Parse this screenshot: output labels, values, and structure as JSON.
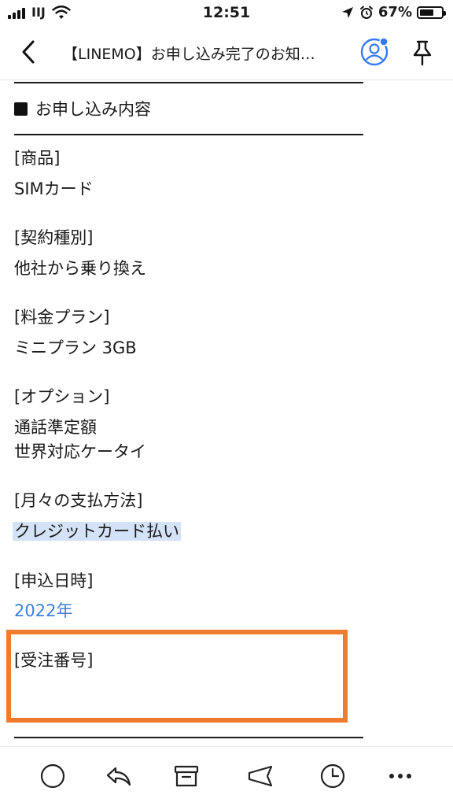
{
  "status_bar": {
    "carrier": "IIJ",
    "time": "12:51",
    "battery_percent_label": "67%",
    "battery_level": 0.67
  },
  "header": {
    "title": "【LINEMO】お申し込み完了のお知…"
  },
  "email": {
    "section_heading": "お申し込み内容",
    "fields": [
      {
        "label": "[商品]",
        "values": [
          "SIMカード"
        ]
      },
      {
        "label": "[契約種別]",
        "values": [
          "他社から乗り換え"
        ]
      },
      {
        "label": "[料金プラン]",
        "values": [
          "ミニプラン 3GB"
        ]
      },
      {
        "label": "[オプション]",
        "values": [
          "通話準定額",
          "世界対応ケータイ"
        ]
      },
      {
        "label": "[月々の支払方法]",
        "values": [
          "クレジットカード払い"
        ]
      },
      {
        "label": "[申込日時]",
        "values": [
          "2022年"
        ]
      },
      {
        "label": "[受注番号]",
        "values": []
      }
    ]
  },
  "colors": {
    "highlight_bg": "#d4e2f7",
    "link": "#3d7fd9",
    "annotation_box": "#f07a2e",
    "notification_dot": "#3478f6"
  },
  "toolbar": {
    "icons": [
      "circle-icon",
      "reply-icon",
      "archive-icon",
      "forward-icon",
      "clock-icon",
      "more-icon"
    ]
  }
}
